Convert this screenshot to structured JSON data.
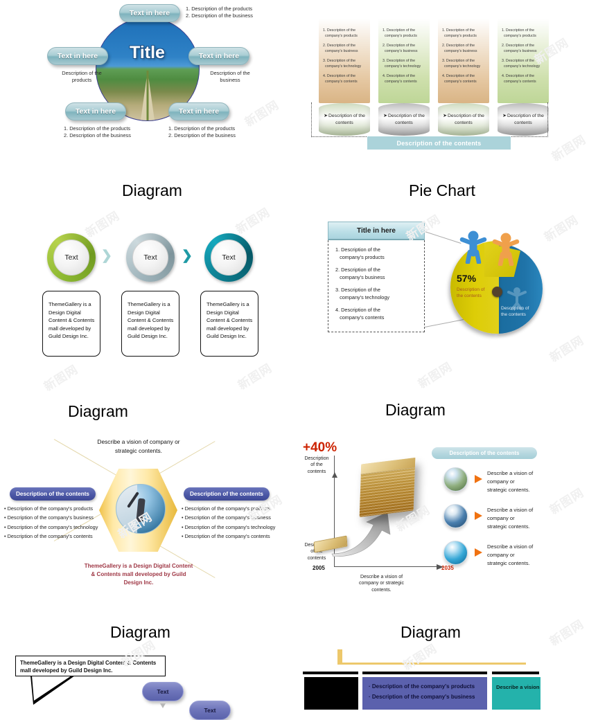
{
  "section_titles": {
    "row1_left": "Diagram",
    "row1_right": "Pie Chart",
    "row2_left": "Diagram",
    "row2_right": "Diagram",
    "row3_left": "Diagram",
    "row3_right": "Diagram"
  },
  "watermark": {
    "text": "新图网"
  },
  "panel_globe": {
    "center_title": "Title",
    "pills": {
      "top": "Text in here",
      "left": "Text in here",
      "right": "Text in here",
      "bottom_left": "Text in here",
      "bottom_right": "Text in here"
    },
    "notes": {
      "top_line1": "1. Description of the products",
      "top_line2": "2. Description of the business",
      "left_line1": "Description of the",
      "left_line2": "products",
      "right_line1": "Description of the",
      "right_line2": "business",
      "bottom_left_line1": "1. Description of the products",
      "bottom_left_line2": "2. Description of the business",
      "bottom_right_line1": "1. Description of the products",
      "bottom_right_line2": "2. Description of the business"
    }
  },
  "panel_cylinders": {
    "items": [
      {
        "color": "tan",
        "base": "green"
      },
      {
        "color": "green",
        "base": "grey"
      },
      {
        "color": "tan",
        "base": "green"
      },
      {
        "color": "green",
        "base": "grey"
      }
    ],
    "list": [
      {
        "num": "1.",
        "l1": "Description of the",
        "l2": "company's products"
      },
      {
        "num": "2.",
        "l1": "Description of the",
        "l2": "company's business"
      },
      {
        "num": "3.",
        "l1": "Description of the",
        "l2": "company's technology"
      },
      {
        "num": "4.",
        "l1": "Description of the",
        "l2": "company's contents"
      }
    ],
    "base_label_line1": "Description of the",
    "base_label_line2": "contents",
    "base_bullet": "➤",
    "bottom_bar_label": "Description of the contents",
    "bottom_bar_color": "#abd3da"
  },
  "panel_circles": {
    "steps": [
      {
        "circle_label": "Text",
        "ring_color": "#8cb832",
        "body": "ThemeGallery is a Design Digital Content & Contents mall developed by Guild Design Inc."
      },
      {
        "circle_label": "Text",
        "ring_color": "#9fb4bb",
        "body": "ThemeGallery is a Design Digital Content & Contents mall developed by Guild Design Inc."
      },
      {
        "circle_label": "Text",
        "ring_color": "#0d7c8e",
        "body": "ThemeGallery is a Design Digital Content & Contents mall developed by Guild Design Inc."
      }
    ],
    "chevrons": [
      {
        "glyph": "❯",
        "color": "#aed6d6"
      },
      {
        "glyph": "❯",
        "color": "#1f9aa5"
      }
    ]
  },
  "panel_pie": {
    "title": "Title in here",
    "list": [
      {
        "l1": "Description of the",
        "l2": "company's products"
      },
      {
        "l1": "Description of the",
        "l2": "company's business"
      },
      {
        "l1": "Description of the",
        "l2": "company's technology"
      },
      {
        "l1": "Description of the",
        "l2": "company's contents"
      }
    ],
    "label_yellow_l1": "Description of",
    "label_yellow_l2": "the contents",
    "label_blue_l1": "Description of",
    "label_blue_l2": "the contents",
    "percent_label": "57%"
  },
  "panel_hexagon": {
    "top_note_l1": "Describe a vision of company or",
    "top_note_l2": "strategic contents.",
    "left_badge": "Description of the contents",
    "right_badge": "Description of the contents",
    "left_bullets": [
      "Description of the company's products",
      "Description of the company's business",
      "Description of the company's technology",
      "Description of the company's contents"
    ],
    "right_bullets": [
      "Description of the company's products",
      "Description of the company's business",
      "Description of the company's technology",
      "Description of the company's contents"
    ],
    "bottom_note_l1": "ThemeGallery is a Design Digital Content",
    "bottom_note_l2": "& Contents mall developed by Guild",
    "bottom_note_l3": "Design Inc.",
    "bottom_note_color": "#9e3644",
    "badge_color": "#4c58a6"
  },
  "panel_growth": {
    "growth_label": "+40%",
    "growth_color": "#cc2200",
    "y_top_l1": "Description",
    "y_top_l2": "of the",
    "y_top_l3": "contents",
    "y_bottom_l1": "Description",
    "y_bottom_l2": "of the",
    "y_bottom_l3": "contents",
    "x_start": "2005",
    "x_end": "2035",
    "x_end_color": "#cc2200",
    "x_caption_l1": "Describe a vision of",
    "x_caption_l2": "company or strategic",
    "x_caption_l3": "contents.",
    "header_pill": "Description of the contents",
    "rows": [
      {
        "l1": "Describe a vision of",
        "l2": "company or",
        "l3": "strategic contents."
      },
      {
        "l1": "Describe a vision of",
        "l2": "company or",
        "l3": "strategic contents."
      },
      {
        "l1": "Describe a vision of",
        "l2": "company or",
        "l3": "strategic contents."
      }
    ]
  },
  "panel_callout": {
    "callout_l1": "ThemeGallery is a Design Digital Content & Contents",
    "callout_l2": "mall developed by Guild Design Inc.",
    "oval1": "Text",
    "oval2": "Text"
  },
  "panel_table": {
    "purple_rows": [
      "Description of the company's products",
      "Description of the company's business"
    ],
    "teal_text_l1": "Describe a vision",
    "purple_color": "#5b61ad",
    "teal_color": "#24b2ab",
    "gold_color": "#edc86b"
  }
}
